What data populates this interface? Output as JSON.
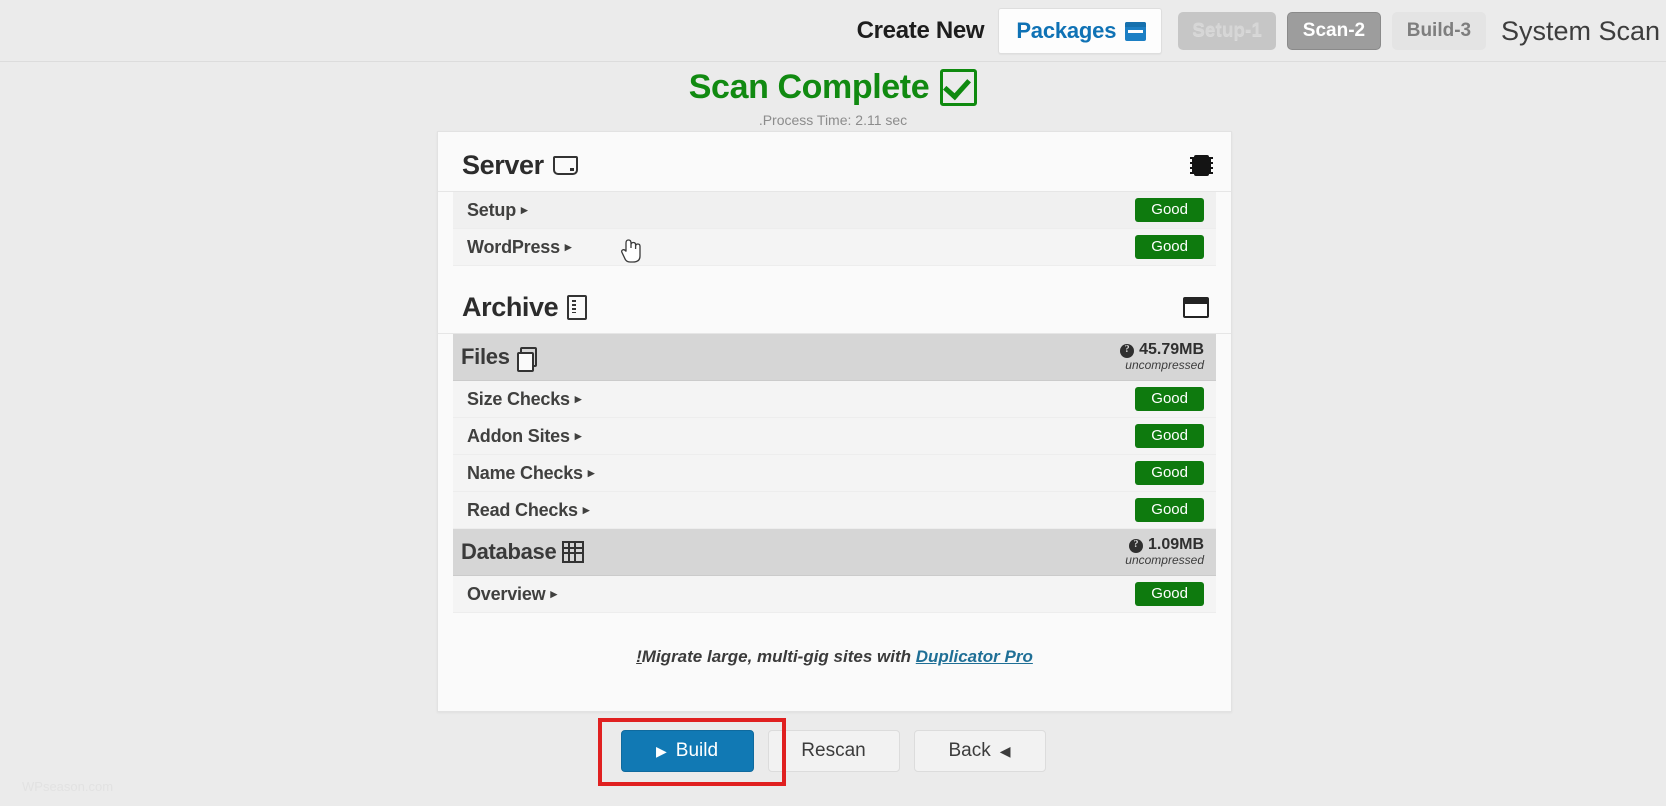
{
  "topbar": {
    "create_new_label": "Create New",
    "packages_label": "Packages",
    "packages_icon": "package-box-icon",
    "steps": [
      {
        "label": "Setup-1",
        "state": "done"
      },
      {
        "label": "Scan-2",
        "state": "active"
      },
      {
        "label": "Build-3",
        "state": "next"
      }
    ],
    "page_title": "System Scan"
  },
  "status": {
    "headline": "Scan Complete",
    "headline_icon": "checkmark-icon",
    "process_time": ".Process Time: 2.11 sec",
    "headline_color": "#118a11"
  },
  "server_section": {
    "title": "Server",
    "title_icon": "hard-drive-icon",
    "right_icon": "chip-icon",
    "rows": [
      {
        "label": "Setup",
        "status": "Good"
      },
      {
        "label": "WordPress",
        "status": "Good"
      }
    ]
  },
  "archive_section": {
    "title": "Archive",
    "title_icon": "archive-file-icon",
    "right_icon": "window-icon",
    "files_group": {
      "label": "Files",
      "icon": "copy-files-icon",
      "size": "45.79MB",
      "size_note": "uncompressed",
      "help_icon": "help-icon"
    },
    "files_rows": [
      {
        "label": "Size Checks",
        "status": "Good"
      },
      {
        "label": "Addon Sites",
        "status": "Good"
      },
      {
        "label": "Name Checks",
        "status": "Good"
      },
      {
        "label": "Read Checks",
        "status": "Good"
      }
    ],
    "database_group": {
      "label": "Database",
      "icon": "table-grid-icon",
      "size": "1.09MB",
      "size_note": "uncompressed",
      "help_icon": "help-icon"
    },
    "database_rows": [
      {
        "label": "Overview",
        "status": "Good"
      }
    ]
  },
  "promo": {
    "bang": "!",
    "text": "Migrate large, multi-gig sites with ",
    "link_label": "Duplicator Pro"
  },
  "footer": {
    "build_label": "Build",
    "build_icon": "play-triangle-icon",
    "rescan_label": "Rescan",
    "back_label": "Back",
    "back_icon": "back-triangle-icon",
    "build_color": "#1179b4",
    "highlight_color": "#e02020"
  },
  "watermark": {
    "text": "WPseason.com"
  },
  "ui": {
    "caret": "▸",
    "play": "▶",
    "back_arrow": "◀",
    "help_glyph": "?"
  }
}
